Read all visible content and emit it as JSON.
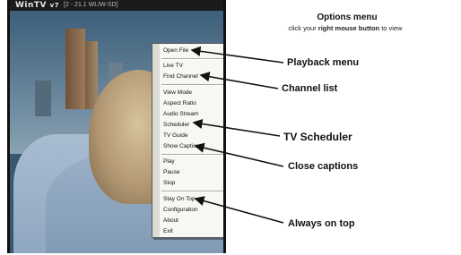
{
  "window": {
    "brand": "WinTV",
    "brand_suffix": "v7",
    "channel_info": "[2 - 21.1   WLIW-SD]"
  },
  "menu": {
    "items": [
      {
        "label": "Open File"
      },
      {
        "label": "Live TV"
      },
      {
        "label": "Find Channel"
      },
      {
        "label": "View Mode"
      },
      {
        "label": "Aspect Ratio"
      },
      {
        "label": "Audio Stream"
      },
      {
        "label": "Scheduler"
      },
      {
        "label": "TV Guide"
      },
      {
        "label": "Show Captions"
      },
      {
        "label": "Play"
      },
      {
        "label": "Pause"
      },
      {
        "label": "Stop"
      },
      {
        "label": "Stay On Top"
      },
      {
        "label": "Configuration"
      },
      {
        "label": "About"
      },
      {
        "label": "Exit"
      }
    ]
  },
  "annotations": {
    "title": "Options menu",
    "subtitle_pre": "click your ",
    "subtitle_bold": "right mouse button",
    "subtitle_post": " to view",
    "playback": "Playback menu",
    "channel_list": "Channel list",
    "tv_scheduler": "TV Scheduler",
    "close_captions": "Close captions",
    "always_on_top": "Always on top"
  }
}
